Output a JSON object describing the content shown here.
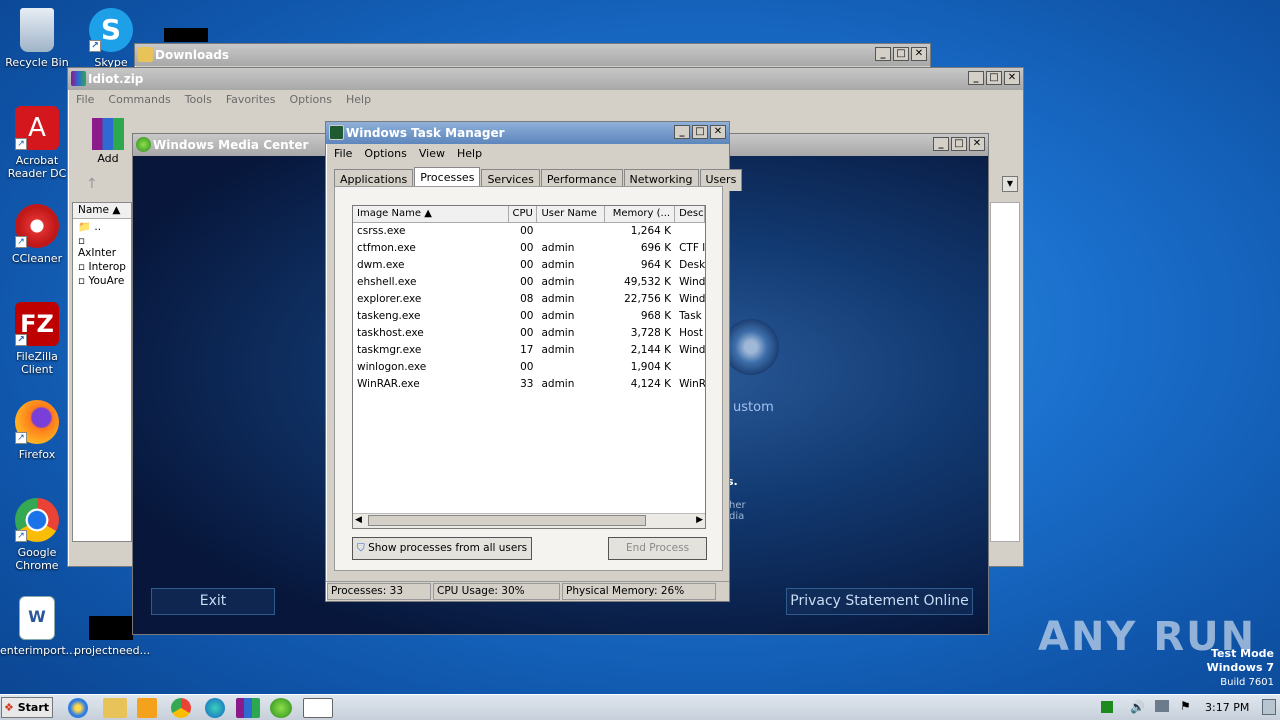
{
  "desktop": {
    "icons": [
      {
        "label": "Recycle Bin",
        "icon": "recycle-bin-icon"
      },
      {
        "label": "Skype",
        "icon": "skype-icon"
      },
      {
        "label": "Acrobat Reader DC",
        "icon": "acrobat-icon"
      },
      {
        "label": "CCleaner",
        "icon": "ccleaner-icon"
      },
      {
        "label": "FileZilla Client",
        "icon": "filezilla-icon"
      },
      {
        "label": "Firefox",
        "icon": "firefox-icon"
      },
      {
        "label": "Google Chrome",
        "icon": "chrome-icon"
      },
      {
        "label": "enterimport...",
        "icon": "word-doc-icon"
      },
      {
        "label": "projectneed...",
        "icon": "black-file-icon"
      }
    ]
  },
  "downloads_window": {
    "title": "Downloads"
  },
  "winrar_window": {
    "title": "Idiot.zip",
    "menu": [
      "File",
      "Commands",
      "Tools",
      "Favorites",
      "Options",
      "Help"
    ],
    "toolbar_add": "Add",
    "name_header": "Name",
    "files": [
      "..",
      "AxInter",
      "Interop",
      "YouAre"
    ]
  },
  "media_center": {
    "title": "Windows Media Center",
    "exit_label": "Exit",
    "privacy_label": "Privacy Statement Online",
    "custom_label": "ustom",
    "fragment_1": "s.",
    "fragment_2": "her",
    "fragment_3": "dia"
  },
  "task_manager": {
    "title": "Windows Task Manager",
    "menu": [
      "File",
      "Options",
      "View",
      "Help"
    ],
    "tabs": [
      "Applications",
      "Processes",
      "Services",
      "Performance",
      "Networking",
      "Users"
    ],
    "active_tab": "Processes",
    "columns": [
      "Image Name",
      "CPU",
      "User Name",
      "Memory (...",
      "Desc"
    ],
    "rows": [
      {
        "name": "csrss.exe",
        "cpu": "00",
        "user": "",
        "mem": "1,264 K",
        "desc": ""
      },
      {
        "name": "ctfmon.exe",
        "cpu": "00",
        "user": "admin",
        "mem": "696 K",
        "desc": "CTF l"
      },
      {
        "name": "dwm.exe",
        "cpu": "00",
        "user": "admin",
        "mem": "964 K",
        "desc": "Desk"
      },
      {
        "name": "ehshell.exe",
        "cpu": "00",
        "user": "admin",
        "mem": "49,532 K",
        "desc": "Wind"
      },
      {
        "name": "explorer.exe",
        "cpu": "08",
        "user": "admin",
        "mem": "22,756 K",
        "desc": "Wind"
      },
      {
        "name": "taskeng.exe",
        "cpu": "00",
        "user": "admin",
        "mem": "968 K",
        "desc": "Task"
      },
      {
        "name": "taskhost.exe",
        "cpu": "00",
        "user": "admin",
        "mem": "3,728 K",
        "desc": "Host"
      },
      {
        "name": "taskmgr.exe",
        "cpu": "17",
        "user": "admin",
        "mem": "2,144 K",
        "desc": "Wind"
      },
      {
        "name": "winlogon.exe",
        "cpu": "00",
        "user": "",
        "mem": "1,904 K",
        "desc": ""
      },
      {
        "name": "WinRAR.exe",
        "cpu": "33",
        "user": "admin",
        "mem": "4,124 K",
        "desc": "WinR"
      }
    ],
    "show_all_label": "Show processes from all users",
    "end_process_label": "End Process",
    "status_processes": "Processes: 33",
    "status_cpu": "CPU Usage: 30%",
    "status_memory": "Physical Memory: 26%"
  },
  "watermark": {
    "brand": "ANY RUN",
    "test_mode": "Test Mode",
    "os": "Windows 7",
    "build": "Build 7601"
  },
  "taskbar": {
    "start_label": "Start",
    "clock": "3:17 PM"
  }
}
